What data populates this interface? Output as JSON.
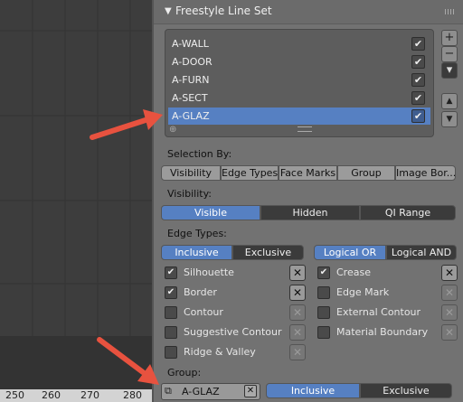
{
  "panel": {
    "title": "Freestyle Line Set",
    "lineset_items": [
      {
        "label": "A-WALL",
        "checked": true
      },
      {
        "label": "A-DOOR",
        "checked": true
      },
      {
        "label": "A-FURN",
        "checked": true
      },
      {
        "label": "A-SECT",
        "checked": true
      },
      {
        "label": "A-GLAZ",
        "checked": true,
        "selected": true
      }
    ],
    "side_buttons": {
      "add": "+",
      "remove": "−",
      "menu": "▾",
      "up": "▲",
      "down": "▼"
    },
    "selection_by_label": "Selection By:",
    "selection_tabs": [
      "Visibility",
      "Edge Types",
      "Face Marks",
      "Group",
      "Image Bor..."
    ],
    "visibility_label": "Visibility:",
    "visibility_options": [
      "Visible",
      "Hidden",
      "QI Range"
    ],
    "visibility_active": "Visible",
    "edge_types_label": "Edge Types:",
    "edge_inclusion": [
      "Inclusive",
      "Exclusive"
    ],
    "edge_inclusion_active": "Inclusive",
    "edge_logic": [
      "Logical OR",
      "Logical AND"
    ],
    "edge_logic_active": "Logical OR",
    "edge_types_left": [
      {
        "label": "Silhouette",
        "checked": true
      },
      {
        "label": "Border",
        "checked": true
      },
      {
        "label": "Contour",
        "checked": false
      },
      {
        "label": "Suggestive Contour",
        "checked": false
      },
      {
        "label": "Ridge & Valley",
        "checked": false
      }
    ],
    "edge_types_right": [
      {
        "label": "Crease",
        "checked": true
      },
      {
        "label": "Edge Mark",
        "checked": false
      },
      {
        "label": "External Contour",
        "checked": false
      },
      {
        "label": "Material Boundary",
        "checked": false
      }
    ],
    "group_label": "Group:",
    "group_value": "A-GLAZ",
    "group_inclusion": [
      "Inclusive",
      "Exclusive"
    ],
    "group_inclusion_active": "Inclusive"
  },
  "timeline": {
    "ticks": [
      "250",
      "260",
      "270",
      "280"
    ]
  },
  "colors": {
    "accent": "#5680c2",
    "annotation_arrow": "#e8523f"
  }
}
